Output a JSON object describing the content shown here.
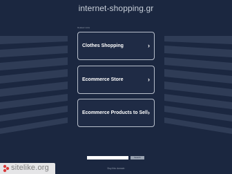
{
  "page": {
    "domain": "internet-shopping.gr",
    "related_heading": "Related Links",
    "footer_link": "Buy this domain",
    "search_button": "Search"
  },
  "links": [
    {
      "label": "Clothes Shopping"
    },
    {
      "label": "Ecommerce Store"
    },
    {
      "label": "Ecommerce Products to Sell"
    }
  ],
  "chevron": "›",
  "watermark": {
    "text": "sitelike.org",
    "icon": "sitelike-logo-icon"
  },
  "colors": {
    "background": "#1b2740",
    "stripe": "#34415a",
    "card_border": "#b9c0cc"
  }
}
